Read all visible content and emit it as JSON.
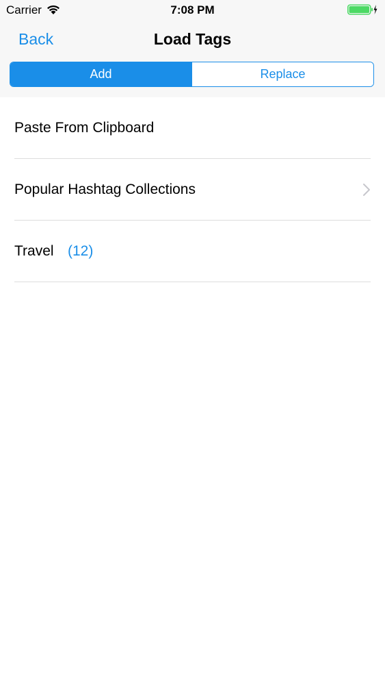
{
  "status_bar": {
    "carrier": "Carrier",
    "time": "7:08 PM",
    "icons": [
      "wifi-icon",
      "battery-icon",
      "charging-bolt-icon"
    ]
  },
  "nav": {
    "back_label": "Back",
    "title": "Load Tags"
  },
  "segmented_control": {
    "segments": [
      {
        "label": "Add",
        "selected": true
      },
      {
        "label": "Replace",
        "selected": false
      }
    ]
  },
  "list": {
    "items": [
      {
        "label": "Paste From Clipboard",
        "count": "",
        "chevron": false
      },
      {
        "label": "Popular Hashtag Collections",
        "count": "",
        "chevron": true
      },
      {
        "label": "Travel",
        "count": "(12)",
        "chevron": false
      }
    ]
  },
  "colors": {
    "accent": "#1a8ee8",
    "bar_background": "#f7f7f7",
    "separator": "#dcdcdc",
    "battery": "#4cd964"
  }
}
